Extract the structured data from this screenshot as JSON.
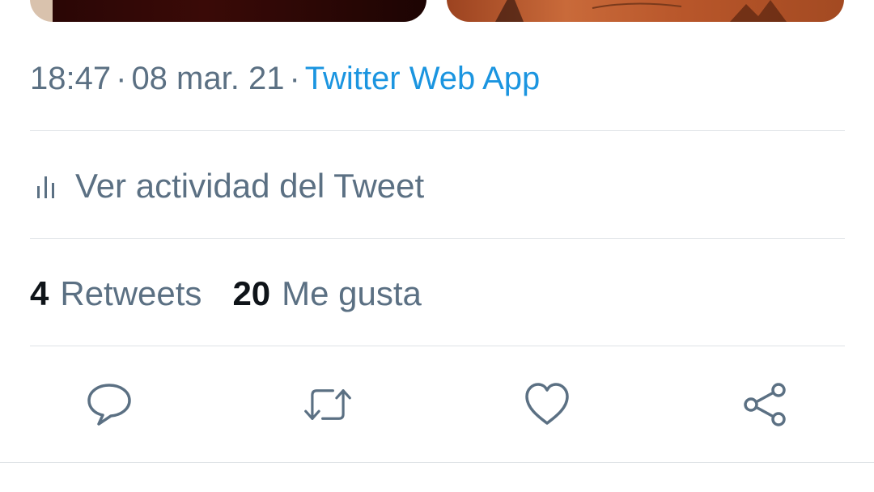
{
  "tweet": {
    "time": "18:47",
    "date": "08 mar. 21",
    "separator": "·",
    "source": "Twitter Web App"
  },
  "activity": {
    "label": "Ver actividad del Tweet",
    "icon": "analytics-bars-icon"
  },
  "stats": {
    "retweets_count": "4",
    "retweets_label": "Retweets",
    "likes_count": "20",
    "likes_label": "Me gusta"
  },
  "actions": [
    {
      "name": "reply",
      "icon": "speech-bubble-icon"
    },
    {
      "name": "retweet",
      "icon": "retweet-arrows-icon"
    },
    {
      "name": "like",
      "icon": "heart-icon"
    },
    {
      "name": "share",
      "icon": "share-nodes-icon"
    }
  ],
  "colors": {
    "muted_text": "#5b7083",
    "link": "#1b95e0",
    "divider": "#dfe3e6",
    "strong_text": "#0f1419"
  }
}
